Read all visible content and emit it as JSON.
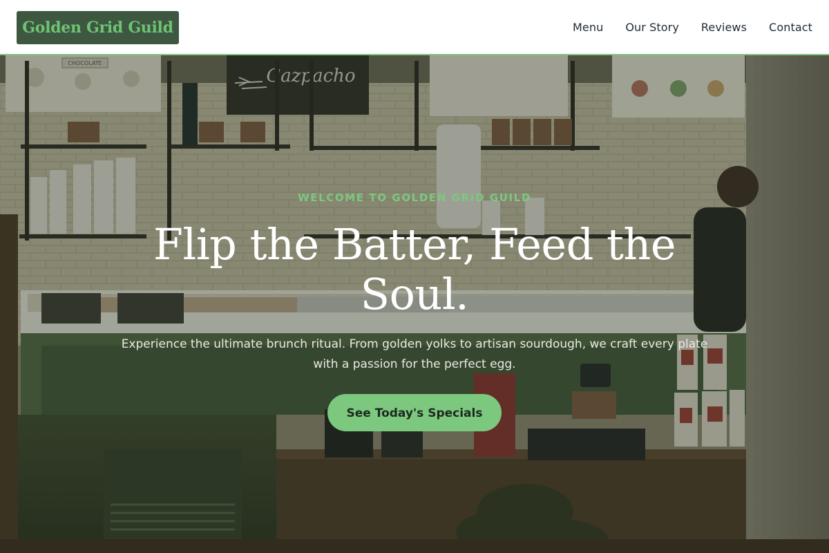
{
  "header": {
    "logo_text": "Golden Grid Guild",
    "nav": [
      {
        "label": "Menu"
      },
      {
        "label": "Our Story"
      },
      {
        "label": "Reviews"
      },
      {
        "label": "Contact"
      }
    ]
  },
  "hero": {
    "eyebrow": "WELCOME TO GOLDEN GRID GUILD",
    "title": "Flip the Batter, Feed the Soul.",
    "subtitle": "Experience the ultimate brunch ritual. From golden yolks to artisan sourdough, we craft every plate with a passion for the perfect egg.",
    "cta_label": "See Today's Specials",
    "background": {
      "chalkboard_text": "Gazpacho",
      "sign_text": "CHOCOLATE"
    }
  },
  "colors": {
    "accent": "#7cc87f",
    "logo_bg": "#3e5741",
    "nav_text": "#1f2a33",
    "hero_text": "#ffffff"
  }
}
